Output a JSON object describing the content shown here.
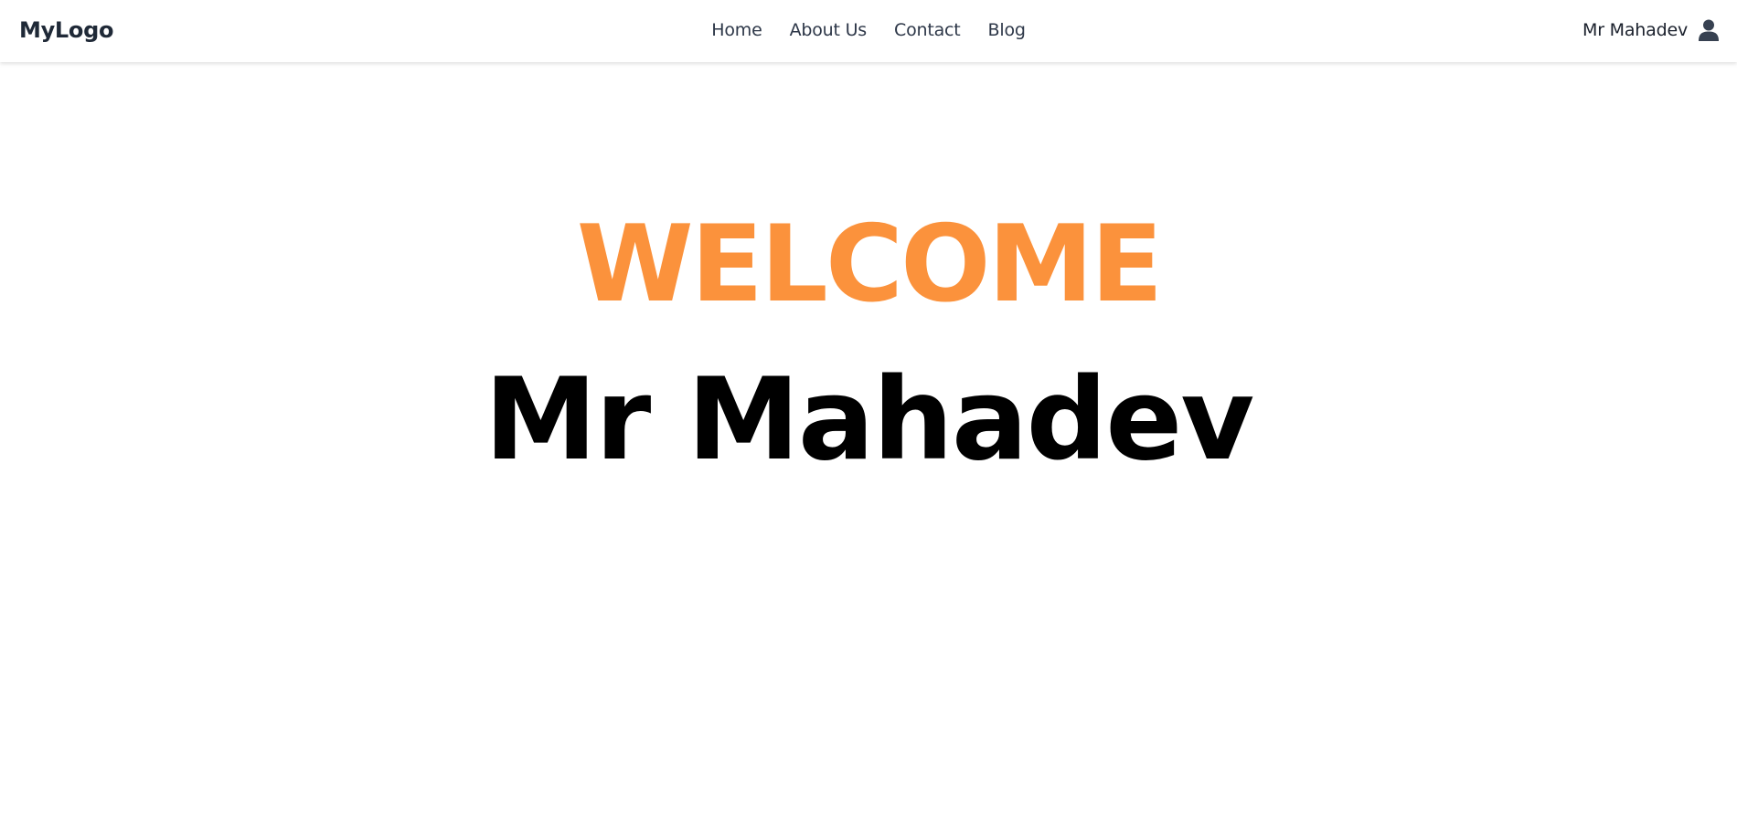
{
  "navbar": {
    "logo": "MyLogo",
    "links": [
      {
        "label": "Home"
      },
      {
        "label": "About Us"
      },
      {
        "label": "Contact"
      },
      {
        "label": "Blog"
      }
    ],
    "user": {
      "name": "Mr Mahadev",
      "icon": "user-icon"
    }
  },
  "hero": {
    "welcome": "WELCOME",
    "name": "Mr Mahadev"
  },
  "colors": {
    "accent": "#fb923c",
    "nav_text": "#2d3748",
    "heading": "#000000"
  }
}
